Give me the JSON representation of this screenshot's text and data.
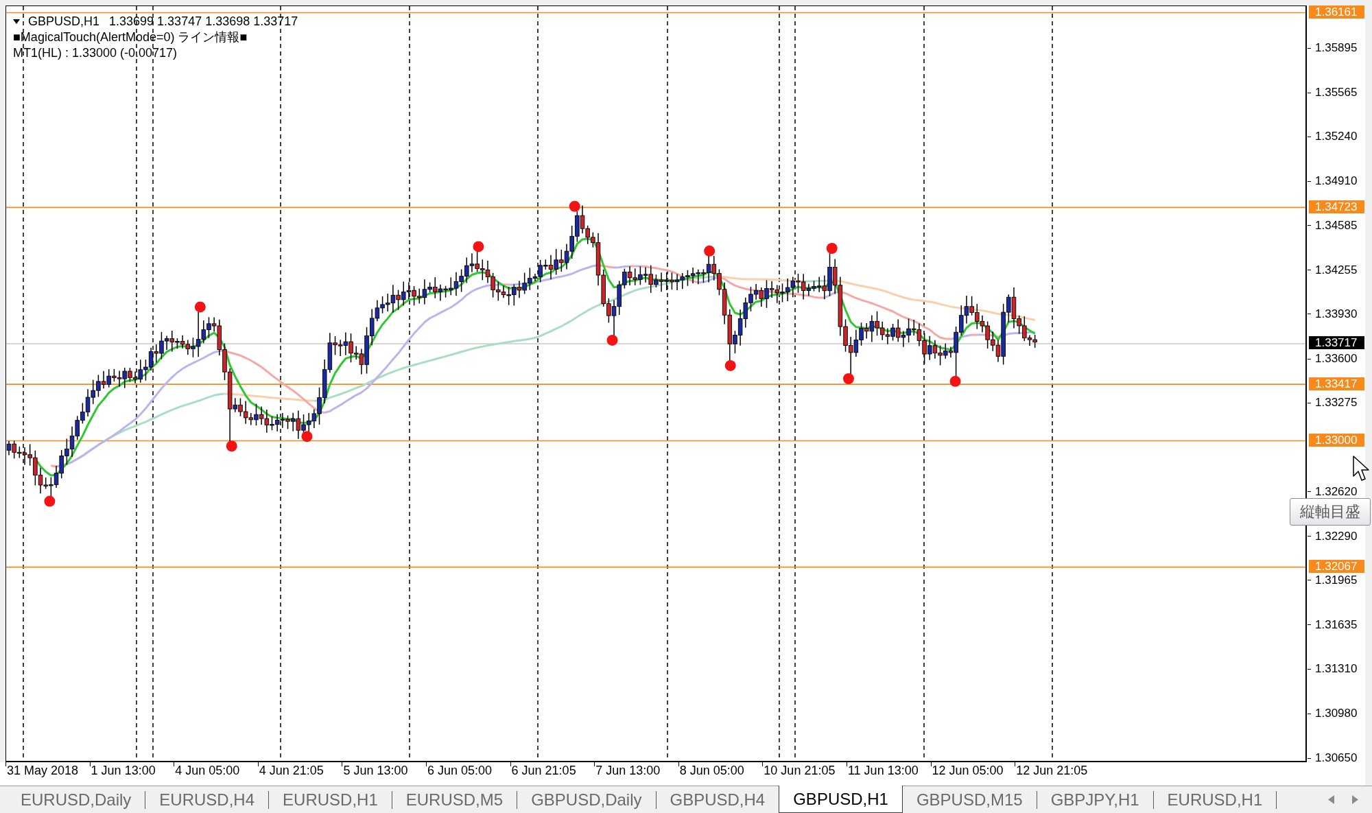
{
  "chart_header": {
    "symbol": "GBPUSD,H1",
    "ohlc": "1.33699 1.33747 1.33698 1.33717",
    "indicator": "■MagicalTouch(AlertMode=0) ライン情報■",
    "line_info": "MT1(HL) : 1.33000 (-0.00717)"
  },
  "price_axis": {
    "ticks": [
      "1.35895",
      "1.35565",
      "1.35240",
      "1.34910",
      "1.34585",
      "1.34255",
      "1.33930",
      "1.33600",
      "1.33275",
      "1.32620",
      "1.32290",
      "1.31965",
      "1.31635",
      "1.31310",
      "1.30980",
      "1.30650"
    ]
  },
  "price_lines": [
    {
      "label": "1.36161",
      "kind": "level"
    },
    {
      "label": "1.34723",
      "kind": "level"
    },
    {
      "label": "1.33717",
      "kind": "current"
    },
    {
      "label": "1.33417",
      "kind": "level"
    },
    {
      "label": "1.33000",
      "kind": "level"
    },
    {
      "label": "1.32067",
      "kind": "level"
    }
  ],
  "time_axis": {
    "labels": [
      "31 May 2018",
      "1 Jun 13:00",
      "4 Jun 05:00",
      "4 Jun 21:05",
      "5 Jun 13:00",
      "6 Jun 05:00",
      "6 Jun 21:05",
      "7 Jun 13:00",
      "8 Jun 05:00",
      "10 Jun 21:05",
      "11 Jun 13:00",
      "12 Jun 05:00",
      "12 Jun 21:05"
    ]
  },
  "tooltip": {
    "text": "縦軸目盛"
  },
  "tabs": [
    {
      "label": "EURUSD,Daily",
      "selected": false
    },
    {
      "label": "EURUSD,H4",
      "selected": false
    },
    {
      "label": "EURUSD,H1",
      "selected": false
    },
    {
      "label": "EURUSD,M5",
      "selected": false
    },
    {
      "label": "GBPUSD,Daily",
      "selected": false
    },
    {
      "label": "GBPUSD,H4",
      "selected": false
    },
    {
      "label": "GBPUSD,H1",
      "selected": true
    },
    {
      "label": "GBPUSD,M15",
      "selected": false
    },
    {
      "label": "GBPJPY,H1",
      "selected": false
    },
    {
      "label": "EURUSD,H1",
      "selected": false
    }
  ]
}
